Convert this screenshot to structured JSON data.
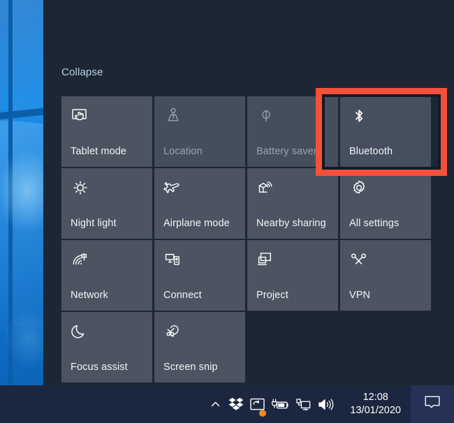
{
  "window": {
    "app": "Windows 10 Action Center",
    "panel_bg": "#1d2633",
    "tile_bg": "#4b5460",
    "highlight_color": "#f4503c"
  },
  "action_center": {
    "collapse_label": "Collapse",
    "tiles": [
      {
        "label": "Tablet mode",
        "icon": "tablet-mode-icon",
        "state": "enabled"
      },
      {
        "label": "Location",
        "icon": "location-icon",
        "state": "disabled"
      },
      {
        "label": "Battery saver",
        "icon": "battery-saver-icon",
        "state": "disabled"
      },
      {
        "label": "Bluetooth",
        "icon": "bluetooth-icon",
        "state": "highlighted"
      },
      {
        "label": "Night light",
        "icon": "night-light-icon",
        "state": "enabled"
      },
      {
        "label": "Airplane mode",
        "icon": "airplane-mode-icon",
        "state": "enabled"
      },
      {
        "label": "Nearby sharing",
        "icon": "nearby-sharing-icon",
        "state": "enabled"
      },
      {
        "label": "All settings",
        "icon": "gear-icon",
        "state": "enabled"
      },
      {
        "label": "Network",
        "icon": "network-icon",
        "state": "enabled"
      },
      {
        "label": "Connect",
        "icon": "connect-icon",
        "state": "enabled"
      },
      {
        "label": "Project",
        "icon": "project-icon",
        "state": "enabled"
      },
      {
        "label": "VPN",
        "icon": "vpn-icon",
        "state": "enabled"
      },
      {
        "label": "Focus assist",
        "icon": "moon-icon",
        "state": "enabled"
      },
      {
        "label": "Screen snip",
        "icon": "screen-snip-icon",
        "state": "enabled"
      }
    ]
  },
  "taskbar": {
    "tray_icons": [
      {
        "name": "show-hidden-icons-chevron-icon"
      },
      {
        "name": "dropbox-icon"
      },
      {
        "name": "display-settings-icon",
        "badge": "orange-dot"
      },
      {
        "name": "battery-charging-icon"
      },
      {
        "name": "network-ethernet-icon"
      },
      {
        "name": "volume-icon"
      }
    ],
    "clock": {
      "time": "12:08",
      "date": "13/01/2020"
    },
    "action_center_button": "notification-bubble-icon"
  }
}
